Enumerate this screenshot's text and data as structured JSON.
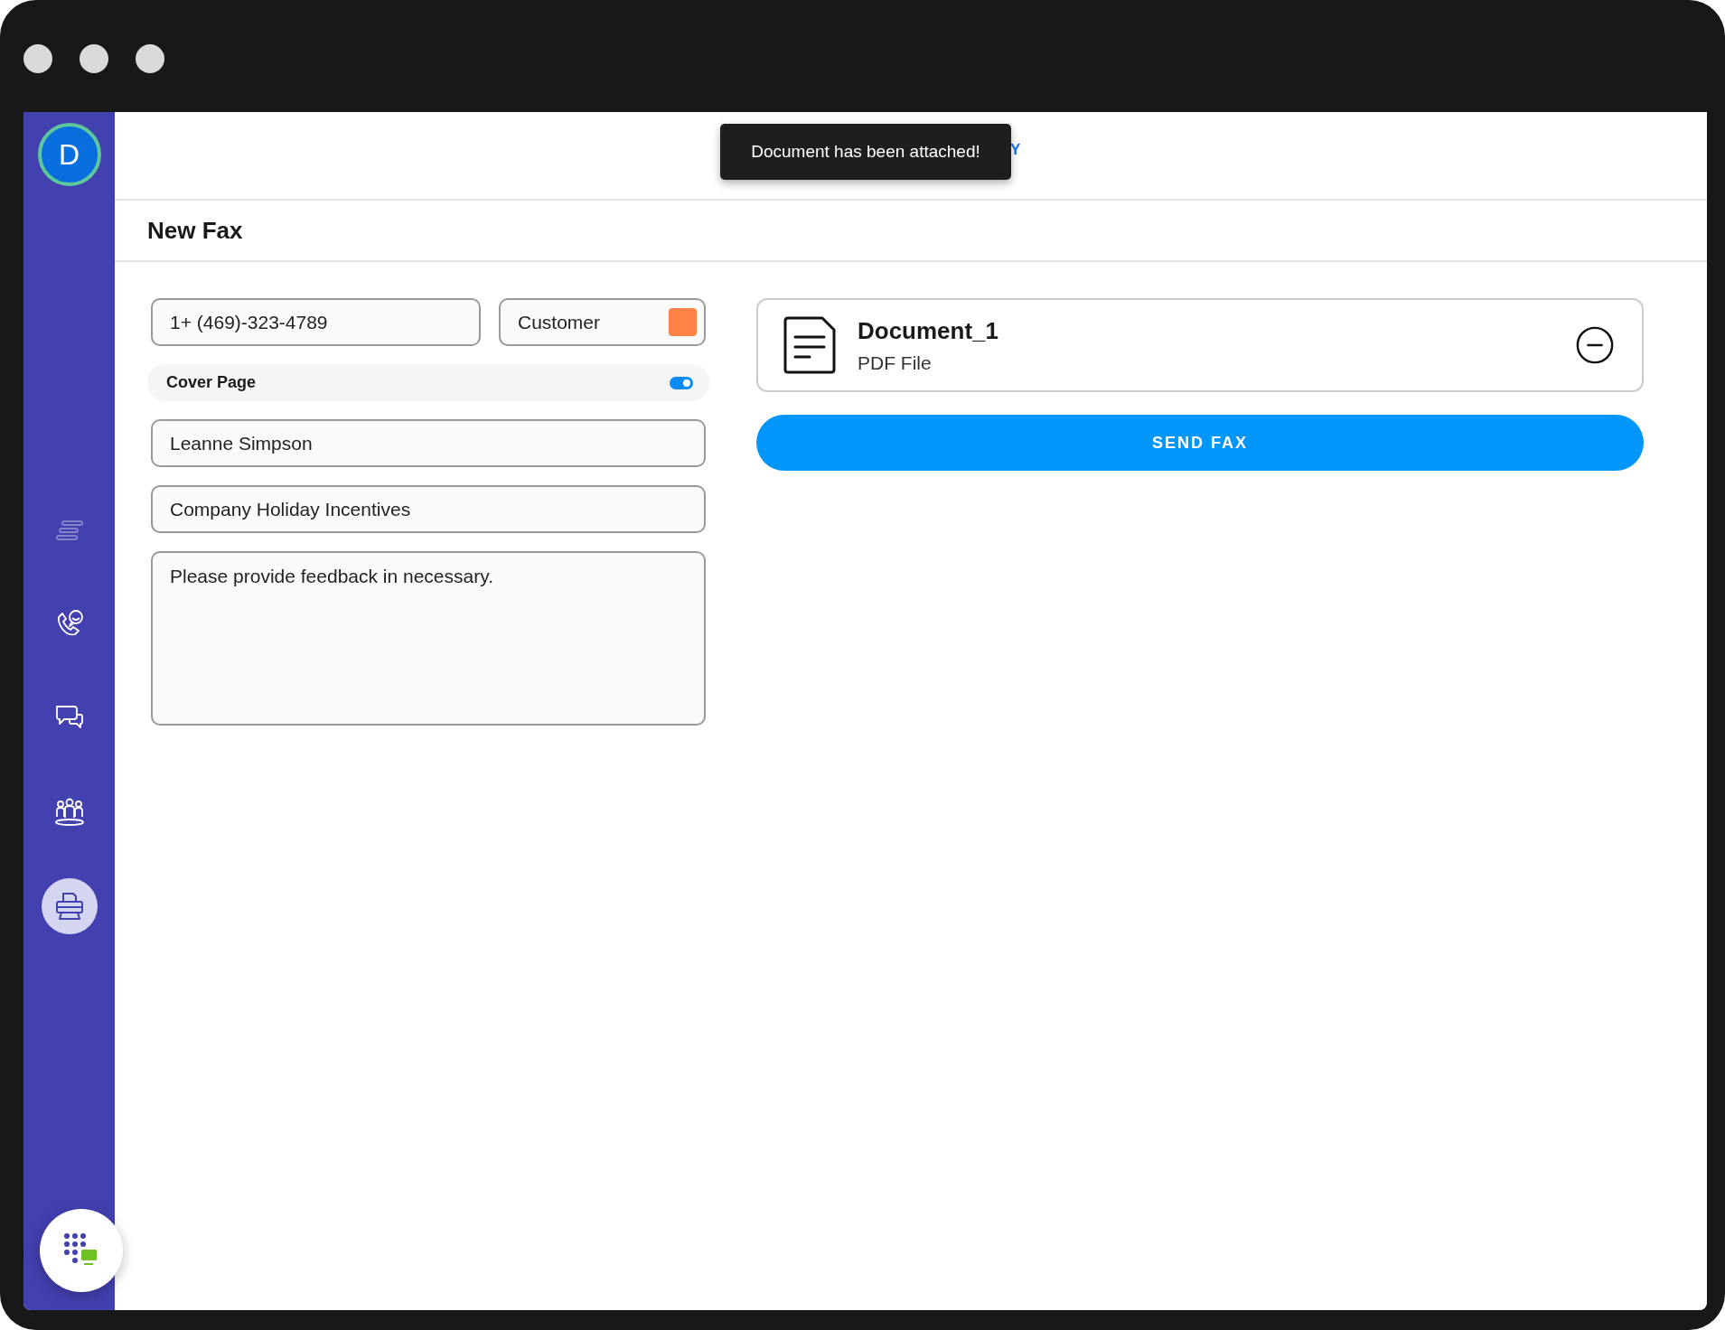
{
  "sidebar": {
    "avatar": "D",
    "items": [
      {
        "kind": "lines",
        "selected": false,
        "disabled": true
      },
      {
        "kind": "calls",
        "selected": false,
        "disabled": false
      },
      {
        "kind": "chat",
        "selected": false,
        "disabled": false
      },
      {
        "kind": "contacts",
        "selected": false,
        "disabled": false
      },
      {
        "kind": "fax",
        "selected": true,
        "disabled": false
      }
    ]
  },
  "header": {
    "partial_text": "Y",
    "toast": "Document has been attached!"
  },
  "page": {
    "title": "New Fax"
  },
  "form": {
    "fax_number": "1+ (469)-323-4789",
    "contact_type": {
      "value": "Customer",
      "color": "#ff8247"
    },
    "cover_page": {
      "label": "Cover Page",
      "on": true
    },
    "recipient": "Leanne Simpson",
    "subject": "Company Holiday Incentives",
    "message": "Please provide feedback in necessary."
  },
  "attachment": {
    "name": "Document_1",
    "type": "PDF File"
  },
  "send_button": "SEND FAX"
}
